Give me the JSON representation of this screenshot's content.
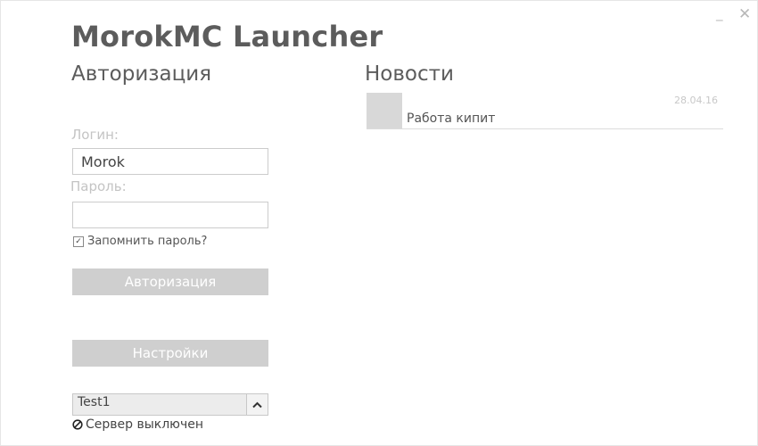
{
  "window": {
    "minimize_label": "_",
    "close_label": "✕"
  },
  "app_title": "MorokMC Launcher",
  "auth": {
    "title": "Авторизация",
    "login_label": "Логин:",
    "login_value": "Morok",
    "password_label": "Пароль:",
    "password_value": "",
    "remember_label": "Запомнить пароль?",
    "remember_checked": true,
    "auth_button": "Авторизация",
    "settings_button": "Настройки"
  },
  "server": {
    "selected": "Test1",
    "status_text": "Сервер выключен",
    "status_icon": "disabled-icon"
  },
  "news": {
    "title": "Новости",
    "items": [
      {
        "date": "28.04.16",
        "text": "Работа кипит"
      }
    ]
  },
  "colors": {
    "title": "#5c5c5c",
    "button_bg": "#cfcfcf",
    "button_text": "#ffffff",
    "label_muted": "#c4c4c4"
  }
}
